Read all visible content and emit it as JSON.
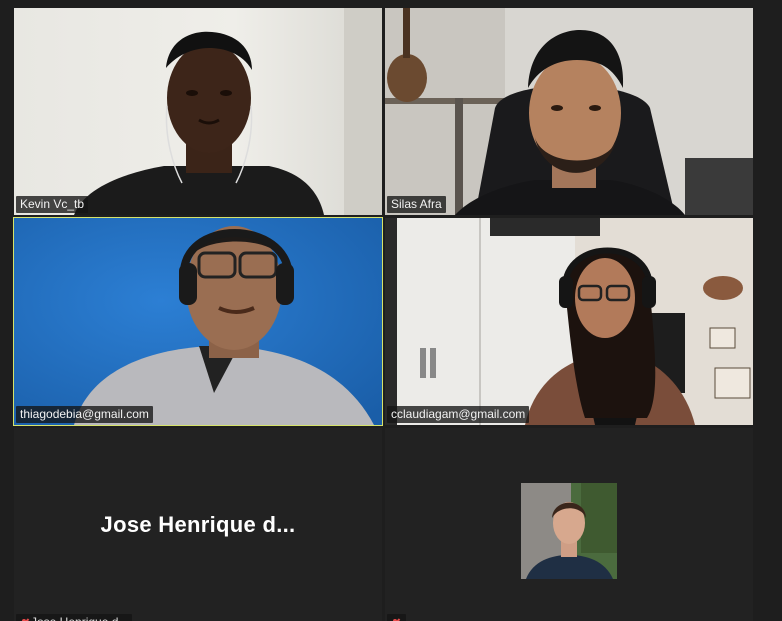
{
  "meeting": {
    "participants": [
      {
        "name": "Kevin Vc_tb",
        "video": true,
        "active_speaker": false
      },
      {
        "name": "Silas Afra",
        "video": true,
        "active_speaker": false
      },
      {
        "name": "thiagodebia@gmail.com",
        "video": true,
        "active_speaker": true
      },
      {
        "name": "cclaudiagam@gmail.com",
        "video": true,
        "active_speaker": false
      },
      {
        "name": "Jose Henrique d...",
        "video": false,
        "muted": true,
        "active_speaker": false
      },
      {
        "name": "",
        "video": false,
        "muted": true,
        "has_avatar": true,
        "active_speaker": false
      }
    ]
  },
  "colors": {
    "background": "#1e1e1e",
    "active_speaker_border": "#d6e36a",
    "mute_red": "#e84a4a",
    "name_tag_bg": "#141414"
  },
  "icons": {
    "mute": "muted-microphone-icon"
  }
}
